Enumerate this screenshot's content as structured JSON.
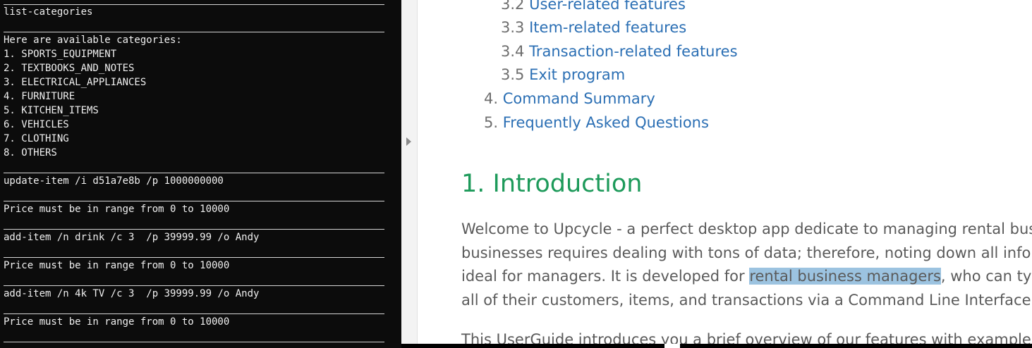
{
  "terminal": {
    "lines": [
      "list-categories",
      "Here are available categories:",
      "1. SPORTS_EQUIPMENT",
      "2. TEXTBOOKS_AND_NOTES",
      "3. ELECTRICAL_APPLIANCES",
      "4. FURNITURE",
      "5. KITCHEN_ITEMS",
      "6. VEHICLES",
      "7. CLOTHING",
      "8. OTHERS",
      "update-item /i d51a7e8b /p 1000000000",
      "Price must be in range from 0 to 10000",
      "add-item /n drink /c 3  /p 39999.99 /o Andy",
      "Price must be in range from 0 to 10000",
      "add-item /n 4k TV /c 3  /p 39999.99 /o Andy",
      "Price must be in range from 0 to 10000"
    ]
  },
  "toc": [
    {
      "num": "3.2",
      "label": "User-related features"
    },
    {
      "num": "3.3",
      "label": "Item-related features"
    },
    {
      "num": "3.4",
      "label": "Transaction-related features"
    },
    {
      "num": "3.5",
      "label": "Exit program"
    },
    {
      "num": "4.",
      "label": "Command Summary"
    },
    {
      "num": "5.",
      "label": "Frequently Asked Questions"
    }
  ],
  "section": {
    "heading": "1. Introduction",
    "para1_line1": "Welcome to Upcycle - a perfect desktop app dedicate to managing rental busi",
    "para1_line2": "businesses requires dealing with tons of data; therefore, noting down all infor",
    "para1_line3_pre": "ideal for managers. It is developed for ",
    "para1_line3_hl": "rental business managers",
    "para1_line3_post": ", who can typ",
    "para1_line4": "all of their customers, items, and transactions via a Command Line Interface.",
    "para2": "This UserGuide introduces you a brief overview of our features with examples"
  },
  "colors": {
    "terminal_bg": "#0c0c0c",
    "terminal_text": "#f0f0f0",
    "link": "#2b6fb4",
    "heading": "#1d9a5a",
    "highlight": "#9cc3e0"
  }
}
